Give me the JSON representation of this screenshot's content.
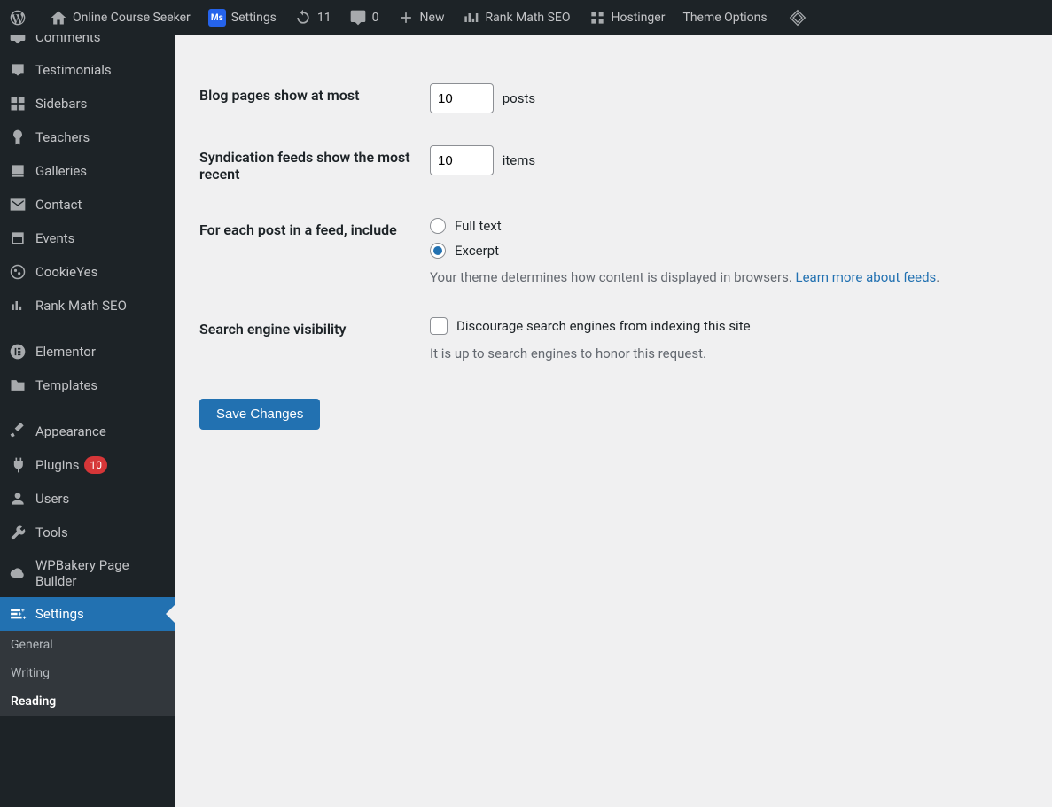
{
  "adminbar": {
    "site_name": "Online Course Seeker",
    "settings": "Settings",
    "updates_count": "11",
    "comments_count": "0",
    "new": "New",
    "rank_math": "Rank Math SEO",
    "hostinger": "Hostinger",
    "theme_options": "Theme Options"
  },
  "sidebar": {
    "comments": "Comments",
    "testimonials": "Testimonials",
    "sidebars": "Sidebars",
    "teachers": "Teachers",
    "galleries": "Galleries",
    "contact": "Contact",
    "events": "Events",
    "cookieyes": "CookieYes",
    "rank_math": "Rank Math SEO",
    "elementor": "Elementor",
    "templates": "Templates",
    "appearance": "Appearance",
    "plugins": "Plugins",
    "plugins_count": "10",
    "users": "Users",
    "tools": "Tools",
    "wpbakery": "WPBakery Page Builder",
    "settings": "Settings",
    "submenu": {
      "general": "General",
      "writing": "Writing",
      "reading": "Reading"
    }
  },
  "form": {
    "blog_pages": {
      "label": "Blog pages show at most",
      "value": "10",
      "suffix": "posts"
    },
    "syndication": {
      "label": "Syndication feeds show the most recent",
      "value": "10",
      "suffix": "items"
    },
    "feed_content": {
      "label": "For each post in a feed, include",
      "full_text": "Full text",
      "excerpt": "Excerpt",
      "description_pre": "Your theme determines how content is displayed in browsers. ",
      "description_link": "Learn more about feeds",
      "description_post": "."
    },
    "search_visibility": {
      "label": "Search engine visibility",
      "checkbox": "Discourage search engines from indexing this site",
      "note": "It is up to search engines to honor this request."
    },
    "submit": "Save Changes"
  }
}
